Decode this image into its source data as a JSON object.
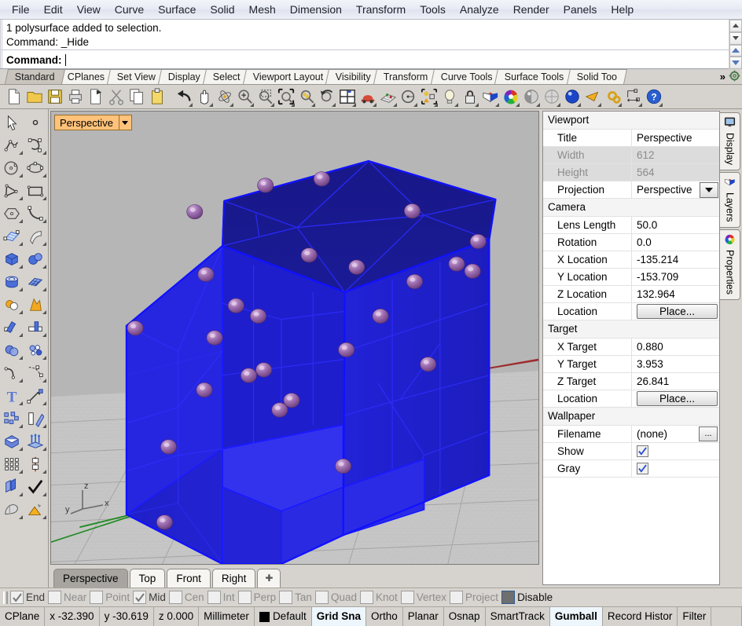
{
  "menubar": {
    "items": [
      "File",
      "Edit",
      "View",
      "Curve",
      "Surface",
      "Solid",
      "Mesh",
      "Dimension",
      "Transform",
      "Tools",
      "Analyze",
      "Render",
      "Panels",
      "Help"
    ]
  },
  "command": {
    "history": [
      "1 polysurface added to selection.",
      "Command: _Hide"
    ],
    "prompt_label": "Command:",
    "prompt_value": ""
  },
  "toolbar_tabs": {
    "items": [
      "Standard",
      "CPlanes",
      "Set View",
      "Display",
      "Select",
      "Viewport Layout",
      "Visibility",
      "Transform",
      "Curve Tools",
      "Surface Tools",
      "Solid Too"
    ],
    "active": "Standard",
    "overflow_label": "»"
  },
  "main_toolbar": {
    "icons": [
      "new-file-icon",
      "open-folder-icon",
      "save-icon",
      "print-icon",
      "copy-to-clipboard-icon",
      "cut-scissors-icon",
      "copy-icon",
      "paste-icon",
      "undo-icon",
      "pan-hand-icon",
      "rotate-view-icon",
      "zoom-in-icon",
      "zoom-window-icon",
      "zoom-extents-icon",
      "zoom-selected-icon",
      "zoom-previous-icon",
      "four-view-layout-icon",
      "car-named-view-icon",
      "cplane-icon",
      "circle-center-icon",
      "select-objects-icon",
      "light-bulb-icon",
      "lock-icon",
      "layers-icon",
      "color-wheel-icon",
      "shaded-sphere-icon",
      "ghosted-sphere-icon",
      "rendered-sphere-icon",
      "render-icon",
      "options-gear-icon",
      "dimension-icon",
      "help-icon"
    ]
  },
  "left_toolbar": {
    "icons": [
      "select-arrow-icon",
      "point-icon",
      "polyline-icon",
      "curve-icon",
      "circle-icon",
      "ellipse-icon",
      "arc-icon",
      "rectangle-icon",
      "polygon-icon",
      "free-curve-icon",
      "surface-patch-icon",
      "surface-sweep-icon",
      "box-icon",
      "sphere-icon",
      "cylinder-icon",
      "surface-mesh-icon",
      "boolean-union-icon",
      "explode-icon",
      "trim-icon",
      "split-icon",
      "boolean-difference-icon",
      "boolean-intersect-icon",
      "fillet-icon",
      "blend-curve-icon",
      "text-icon",
      "leader-icon",
      "array-icon",
      "mirror-icon",
      "cap-icon",
      "extrude-icon",
      "rectangular-array-icon",
      "rail-revolve-icon",
      "offset-surface-icon",
      "check-icon",
      "mesh-from-surface-icon",
      "render-color-icon"
    ]
  },
  "viewport": {
    "title_label": "Perspective",
    "axis_labels": {
      "x": "x",
      "y": "y",
      "z": "z"
    },
    "tabs": [
      {
        "label": "Perspective",
        "active": true
      },
      {
        "label": "Top",
        "active": false
      },
      {
        "label": "Front",
        "active": false
      },
      {
        "label": "Right",
        "active": false
      }
    ],
    "add_tab_label": "✚",
    "model": {
      "description": "blue shaded faceted polysurface cube with purple point markers",
      "surface_color": "#2222dd",
      "edge_color": "#1010ff",
      "marker_color": "#9a6aa8",
      "background_color": "#b6b6b6",
      "ground_color": "#c3c3c3"
    }
  },
  "properties_panel": {
    "sections": [
      {
        "header": "Viewport",
        "rows": [
          {
            "name": "viewport-title",
            "key": "Title",
            "value": "Perspective",
            "dim": false,
            "control": "text"
          },
          {
            "name": "viewport-width",
            "key": "Width",
            "value": "612",
            "dim": true,
            "control": "text"
          },
          {
            "name": "viewport-height",
            "key": "Height",
            "value": "564",
            "dim": true,
            "control": "text"
          },
          {
            "name": "viewport-projection",
            "key": "Projection",
            "value": "Perspective",
            "dim": false,
            "control": "dropdown"
          }
        ]
      },
      {
        "header": "Camera",
        "rows": [
          {
            "name": "camera-lens-length",
            "key": "Lens Length",
            "value": "50.0",
            "dim": false,
            "control": "text"
          },
          {
            "name": "camera-rotation",
            "key": "Rotation",
            "value": "0.0",
            "dim": false,
            "control": "text"
          },
          {
            "name": "camera-x-location",
            "key": "X Location",
            "value": "-135.214",
            "dim": false,
            "control": "text"
          },
          {
            "name": "camera-y-location",
            "key": "Y Location",
            "value": "-153.709",
            "dim": false,
            "control": "text"
          },
          {
            "name": "camera-z-location",
            "key": "Z Location",
            "value": "132.964",
            "dim": false,
            "control": "text"
          },
          {
            "name": "camera-location",
            "key": "Location",
            "value": "Place...",
            "dim": false,
            "control": "button"
          }
        ]
      },
      {
        "header": "Target",
        "rows": [
          {
            "name": "target-x",
            "key": "X Target",
            "value": "0.880",
            "dim": false,
            "control": "text"
          },
          {
            "name": "target-y",
            "key": "Y Target",
            "value": "3.953",
            "dim": false,
            "control": "text"
          },
          {
            "name": "target-z",
            "key": "Z Target",
            "value": "26.841",
            "dim": false,
            "control": "text"
          },
          {
            "name": "target-location",
            "key": "Location",
            "value": "Place...",
            "dim": false,
            "control": "button"
          }
        ]
      },
      {
        "header": "Wallpaper",
        "rows": [
          {
            "name": "wallpaper-filename",
            "key": "Filename",
            "value": "(none)",
            "dim": false,
            "control": "browse"
          },
          {
            "name": "wallpaper-show",
            "key": "Show",
            "value": "",
            "dim": false,
            "control": "checkbox",
            "checked": true
          },
          {
            "name": "wallpaper-gray",
            "key": "Gray",
            "value": "",
            "dim": false,
            "control": "checkbox",
            "checked": true
          }
        ]
      }
    ]
  },
  "side_tabs": [
    {
      "label": "Display",
      "icon": "monitor-icon"
    },
    {
      "label": "Layers",
      "icon": "layers-icon"
    },
    {
      "label": "Properties",
      "icon": "color-wheel-icon"
    }
  ],
  "osnap_bar": {
    "items": [
      {
        "label": "End",
        "checked": true
      },
      {
        "label": "Near",
        "checked": false
      },
      {
        "label": "Point",
        "checked": false
      },
      {
        "label": "Mid",
        "checked": true
      },
      {
        "label": "Cen",
        "checked": false
      },
      {
        "label": "Int",
        "checked": false
      },
      {
        "label": "Perp",
        "checked": false
      },
      {
        "label": "Tan",
        "checked": false
      },
      {
        "label": "Quad",
        "checked": false
      },
      {
        "label": "Knot",
        "checked": false
      },
      {
        "label": "Vertex",
        "checked": false
      },
      {
        "label": "Project",
        "checked": false
      }
    ],
    "disable_label": "Disable"
  },
  "status_bar": {
    "cplane_label": "CPlane",
    "x_label": "x -32.390",
    "y_label": "y -30.619",
    "z_label": "z 0.000",
    "units_label": "Millimeter",
    "layer_label": "Default",
    "layer_color": "#000000",
    "toggles": [
      {
        "label": "Grid Sna",
        "on": true
      },
      {
        "label": "Ortho",
        "on": false
      },
      {
        "label": "Planar",
        "on": false
      },
      {
        "label": "Osnap",
        "on": false
      },
      {
        "label": "SmartTrack",
        "on": false
      },
      {
        "label": "Gumball",
        "on": true
      },
      {
        "label": "Record Histor",
        "on": false
      },
      {
        "label": "Filter",
        "on": false
      }
    ]
  }
}
